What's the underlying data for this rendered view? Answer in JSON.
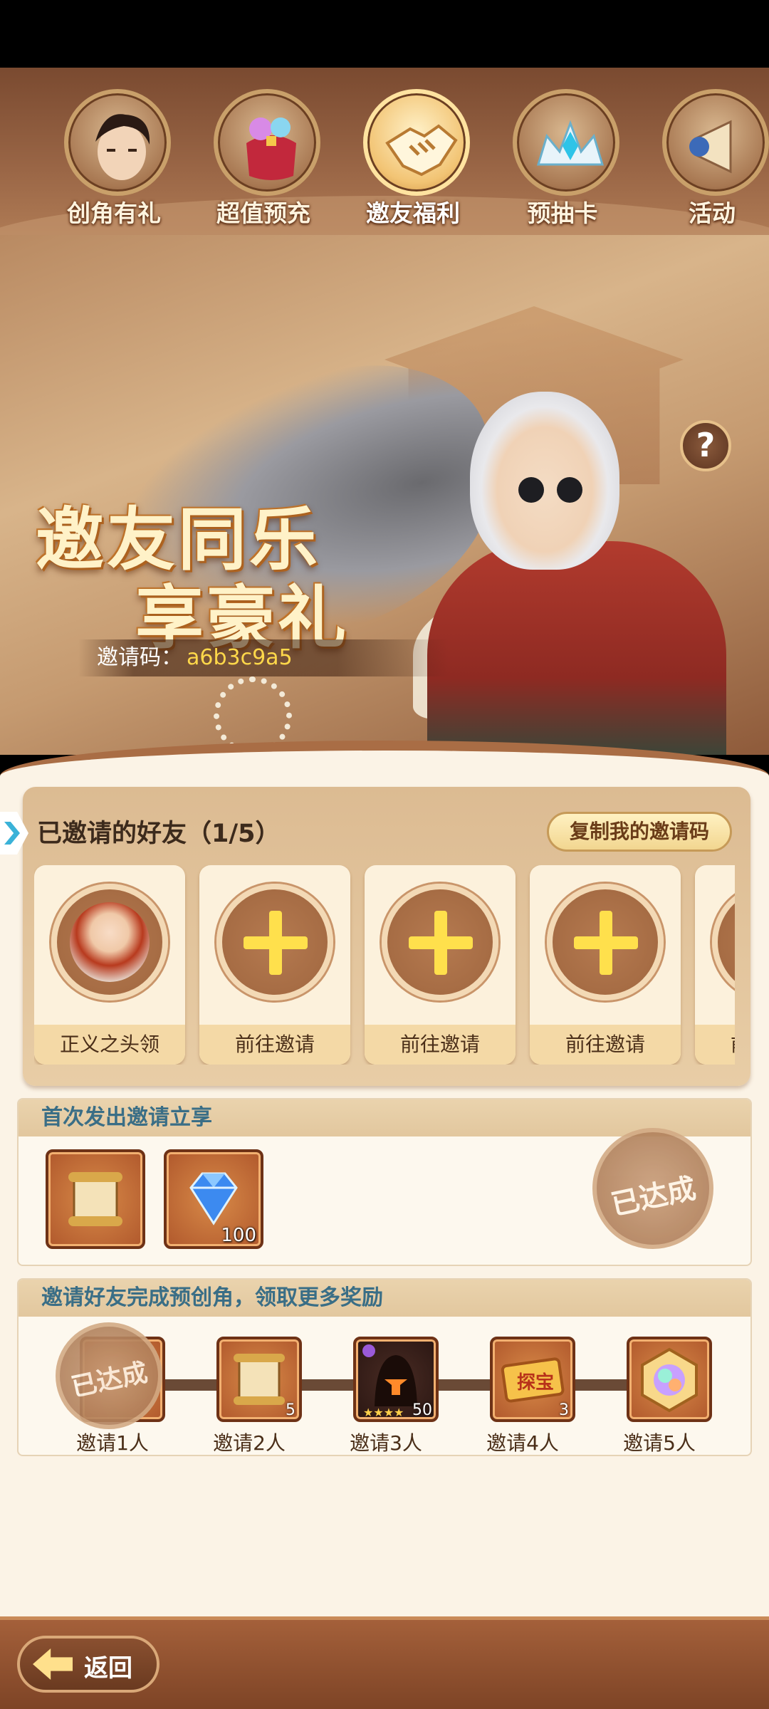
{
  "tabs": [
    {
      "label": "创角有礼",
      "icon": "character-portrait-icon",
      "active": false
    },
    {
      "label": "超值预充",
      "icon": "gift-bag-icon",
      "active": false
    },
    {
      "label": "邀友福利",
      "icon": "handshake-icon",
      "active": true
    },
    {
      "label": "预抽卡",
      "icon": "crystal-crown-icon",
      "active": false
    },
    {
      "label": "活动",
      "icon": "megaphone-icon",
      "active": false
    }
  ],
  "banner": {
    "title_line1": "邀友同乐",
    "title_line2": "享豪礼",
    "invite_code_label": "邀请码：",
    "invite_code_value": "a6b3c9a5",
    "help_symbol": "?"
  },
  "friends": {
    "title": "已邀请的好友（1/5）",
    "copy_button": "复制我的邀请码",
    "slots": [
      {
        "label": "正义之头领",
        "filled": true
      },
      {
        "label": "前往邀请",
        "filled": false
      },
      {
        "label": "前往邀请",
        "filled": false
      },
      {
        "label": "前往邀请",
        "filled": false
      },
      {
        "label": "前往邀请",
        "filled": false
      }
    ]
  },
  "first_invite": {
    "title": "首次发出邀请立享",
    "items": [
      {
        "name": "scroll-icon",
        "qty": ""
      },
      {
        "name": "diamond-icon",
        "qty": "100"
      }
    ],
    "status": "已达成"
  },
  "more_rewards": {
    "title": "邀请好友完成预创角，领取更多奖励",
    "milestones": [
      {
        "label": "邀请1人",
        "icon": "scroll-icon",
        "qty": "",
        "status": "已达成"
      },
      {
        "label": "邀请2人",
        "icon": "scroll-icon",
        "qty": "5"
      },
      {
        "label": "邀请3人",
        "icon": "hero-fragment-icon",
        "qty": "50",
        "stars": "★★★★"
      },
      {
        "label": "邀请4人",
        "icon": "treasure-ticket-icon",
        "qty": "3",
        "ticket_text": "探宝"
      },
      {
        "label": "邀请5人",
        "icon": "rainbow-gem-icon",
        "qty": ""
      }
    ]
  },
  "footer": {
    "back_label": "返回"
  }
}
